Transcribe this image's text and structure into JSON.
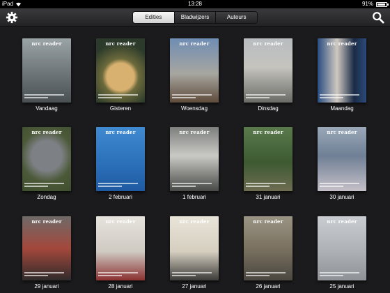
{
  "status": {
    "carrier": "iPad",
    "time": "13:28",
    "battery_text": "91%",
    "battery_level": 0.91
  },
  "toolbar": {
    "settings_icon": "gear-icon",
    "search_icon": "search-icon",
    "tabs": [
      {
        "label": "Edities",
        "active": true
      },
      {
        "label": "Bladwijzers",
        "active": false
      },
      {
        "label": "Auteurs",
        "active": false
      }
    ]
  },
  "masthead": {
    "word1": "nrc",
    "word2": "reader"
  },
  "editions": [
    {
      "label": "Vandaag",
      "bg": "linear-gradient(#9aa3a6, #6d7579 55%, #4a5052)"
    },
    {
      "label": "Gisteren",
      "bg": "radial-gradient(circle at 50% 60%, #d8b070 0 30%, #6c6a3c 40%, #2b3a2a 75%)"
    },
    {
      "label": "Woensdag",
      "bg": "linear-gradient(#6f8db4, #a7a6a0 55%, #5e4a3a)"
    },
    {
      "label": "Dinsdag",
      "bg": "linear-gradient(#b8bcc0, #c5c4bf 45%, #6a6b66)"
    },
    {
      "label": "Maandag",
      "bg": "linear-gradient(90deg, #2a4d80, #cfc8c0 40%, #1a2b46 75%, #2c4a7a)"
    },
    {
      "label": "Zondag",
      "bg": "radial-gradient(circle at 50% 45%, #7d8084 0 35%, #4d5a3a 60%, #3e4e2c)"
    },
    {
      "label": "2 februari",
      "bg": "linear-gradient(#3f8ad0, #2a6fb8 60%, #1e5aa0)"
    },
    {
      "label": "1 februari",
      "bg": "linear-gradient(#7d7f7d, #c9c9c5 45%, #474946)"
    },
    {
      "label": "31 januari",
      "bg": "linear-gradient(#5a7a4c, #3d5a32 55%, #6e6c52)"
    },
    {
      "label": "30 januari",
      "bg": "linear-gradient(#9aa8b8, #6f7f95 45%, #c5c0c8)"
    },
    {
      "label": "29 januari",
      "bg": "linear-gradient(#6e6a68, #a4483c 50%, #2f2b2b)"
    },
    {
      "label": "28 januari",
      "bg": "linear-gradient(#e6e3dd, #cfcac2 55%, #8a3030)"
    },
    {
      "label": "27 januari",
      "bg": "linear-gradient(#e8e4d8, #d6cfc0 55%, #3a3a38)"
    },
    {
      "label": "26 januari",
      "bg": "linear-gradient(#9a9484, #7a7160 50%, #4a4740)"
    },
    {
      "label": "25 januari",
      "bg": "linear-gradient(#c9ccd0, #b0b4b8 50%, #8e9296)"
    }
  ]
}
